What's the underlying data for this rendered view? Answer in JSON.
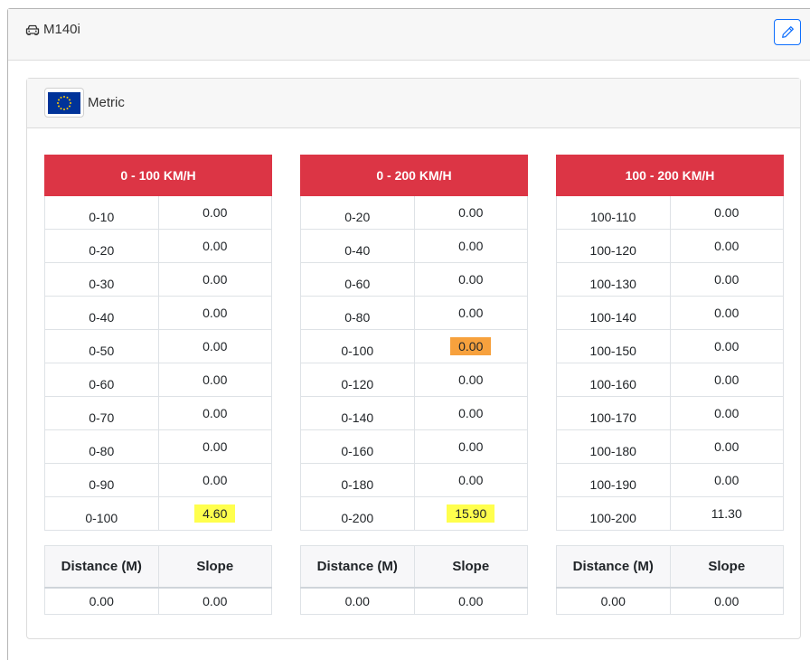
{
  "vehicle": {
    "name": "M140i",
    "icon": "car-icon",
    "edit_icon": "pencil-icon"
  },
  "units": {
    "label": "Metric",
    "flag_icon": "eu-flag-icon"
  },
  "colors": {
    "header_red": "#dc3545",
    "highlight_yellow": "#ffff4d",
    "highlight_orange": "#f7a13d",
    "edit_blue": "#0d6efd"
  },
  "tables": [
    {
      "title": "0 - 100 KM/H",
      "rows": [
        {
          "range": "0-10",
          "time": "0.00",
          "highlight": ""
        },
        {
          "range": "0-20",
          "time": "0.00",
          "highlight": ""
        },
        {
          "range": "0-30",
          "time": "0.00",
          "highlight": ""
        },
        {
          "range": "0-40",
          "time": "0.00",
          "highlight": ""
        },
        {
          "range": "0-50",
          "time": "0.00",
          "highlight": ""
        },
        {
          "range": "0-60",
          "time": "0.00",
          "highlight": ""
        },
        {
          "range": "0-70",
          "time": "0.00",
          "highlight": ""
        },
        {
          "range": "0-80",
          "time": "0.00",
          "highlight": ""
        },
        {
          "range": "0-90",
          "time": "0.00",
          "highlight": ""
        },
        {
          "range": "0-100",
          "time": "4.60",
          "highlight": "yellow"
        }
      ],
      "distance_header": "Distance (M)",
      "slope_header": "Slope",
      "distance": "0.00",
      "slope": "0.00"
    },
    {
      "title": "0 - 200 KM/H",
      "rows": [
        {
          "range": "0-20",
          "time": "0.00",
          "highlight": ""
        },
        {
          "range": "0-40",
          "time": "0.00",
          "highlight": ""
        },
        {
          "range": "0-60",
          "time": "0.00",
          "highlight": ""
        },
        {
          "range": "0-80",
          "time": "0.00",
          "highlight": ""
        },
        {
          "range": "0-100",
          "time": "0.00",
          "highlight": "orange"
        },
        {
          "range": "0-120",
          "time": "0.00",
          "highlight": ""
        },
        {
          "range": "0-140",
          "time": "0.00",
          "highlight": ""
        },
        {
          "range": "0-160",
          "time": "0.00",
          "highlight": ""
        },
        {
          "range": "0-180",
          "time": "0.00",
          "highlight": ""
        },
        {
          "range": "0-200",
          "time": "15.90",
          "highlight": "yellow"
        }
      ],
      "distance_header": "Distance (M)",
      "slope_header": "Slope",
      "distance": "0.00",
      "slope": "0.00"
    },
    {
      "title": "100 - 200 KM/H",
      "rows": [
        {
          "range": "100-110",
          "time": "0.00",
          "highlight": ""
        },
        {
          "range": "100-120",
          "time": "0.00",
          "highlight": ""
        },
        {
          "range": "100-130",
          "time": "0.00",
          "highlight": ""
        },
        {
          "range": "100-140",
          "time": "0.00",
          "highlight": ""
        },
        {
          "range": "100-150",
          "time": "0.00",
          "highlight": ""
        },
        {
          "range": "100-160",
          "time": "0.00",
          "highlight": ""
        },
        {
          "range": "100-170",
          "time": "0.00",
          "highlight": ""
        },
        {
          "range": "100-180",
          "time": "0.00",
          "highlight": ""
        },
        {
          "range": "100-190",
          "time": "0.00",
          "highlight": ""
        },
        {
          "range": "100-200",
          "time": "11.30",
          "highlight": ""
        }
      ],
      "distance_header": "Distance (M)",
      "slope_header": "Slope",
      "distance": "0.00",
      "slope": "0.00"
    }
  ]
}
